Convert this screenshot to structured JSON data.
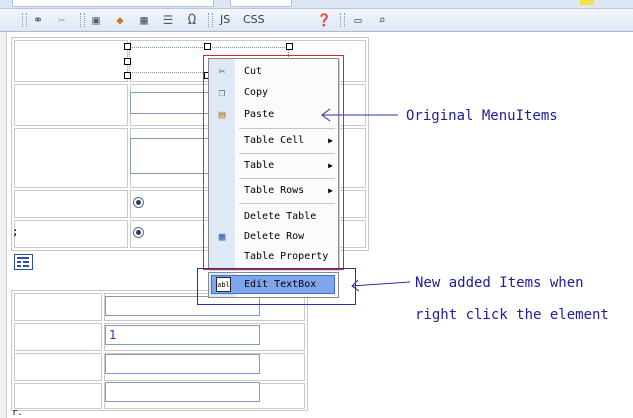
{
  "toolbar": {
    "js_label": "JS",
    "css_label": "CSS",
    "icons": [
      "link-icon",
      "unlink-icon",
      "image-icon",
      "flash-icon",
      "table-icon",
      "horizontal-rule-icon",
      "omega-icon",
      "help-icon",
      "preview-icon",
      "zoom-icon"
    ]
  },
  "menu": {
    "cut": "Cut",
    "copy": "Copy",
    "paste": "Paste",
    "table_cell": "Table Cell",
    "table": "Table",
    "table_rows": "Table Rows",
    "delete_table": "Delete Table",
    "delete_row": "Delete Row",
    "table_property": "Table Property",
    "edit_textbox": "Edit TextBox",
    "edit_textbox_icon_text": "abl"
  },
  "form": {
    "textbox_value": "1",
    "row_label_fragment": ";",
    "bottom_fragment": "r."
  },
  "annotations": {
    "original": "Original MenuItems",
    "new_line1": "New added Items when",
    "new_line2": "right click the element"
  },
  "colors": {
    "annotation_text": "#1c1c9c",
    "original_box": "#d8262b",
    "new_box": "#2b2fa8",
    "highlight": "#7fa6ec"
  }
}
